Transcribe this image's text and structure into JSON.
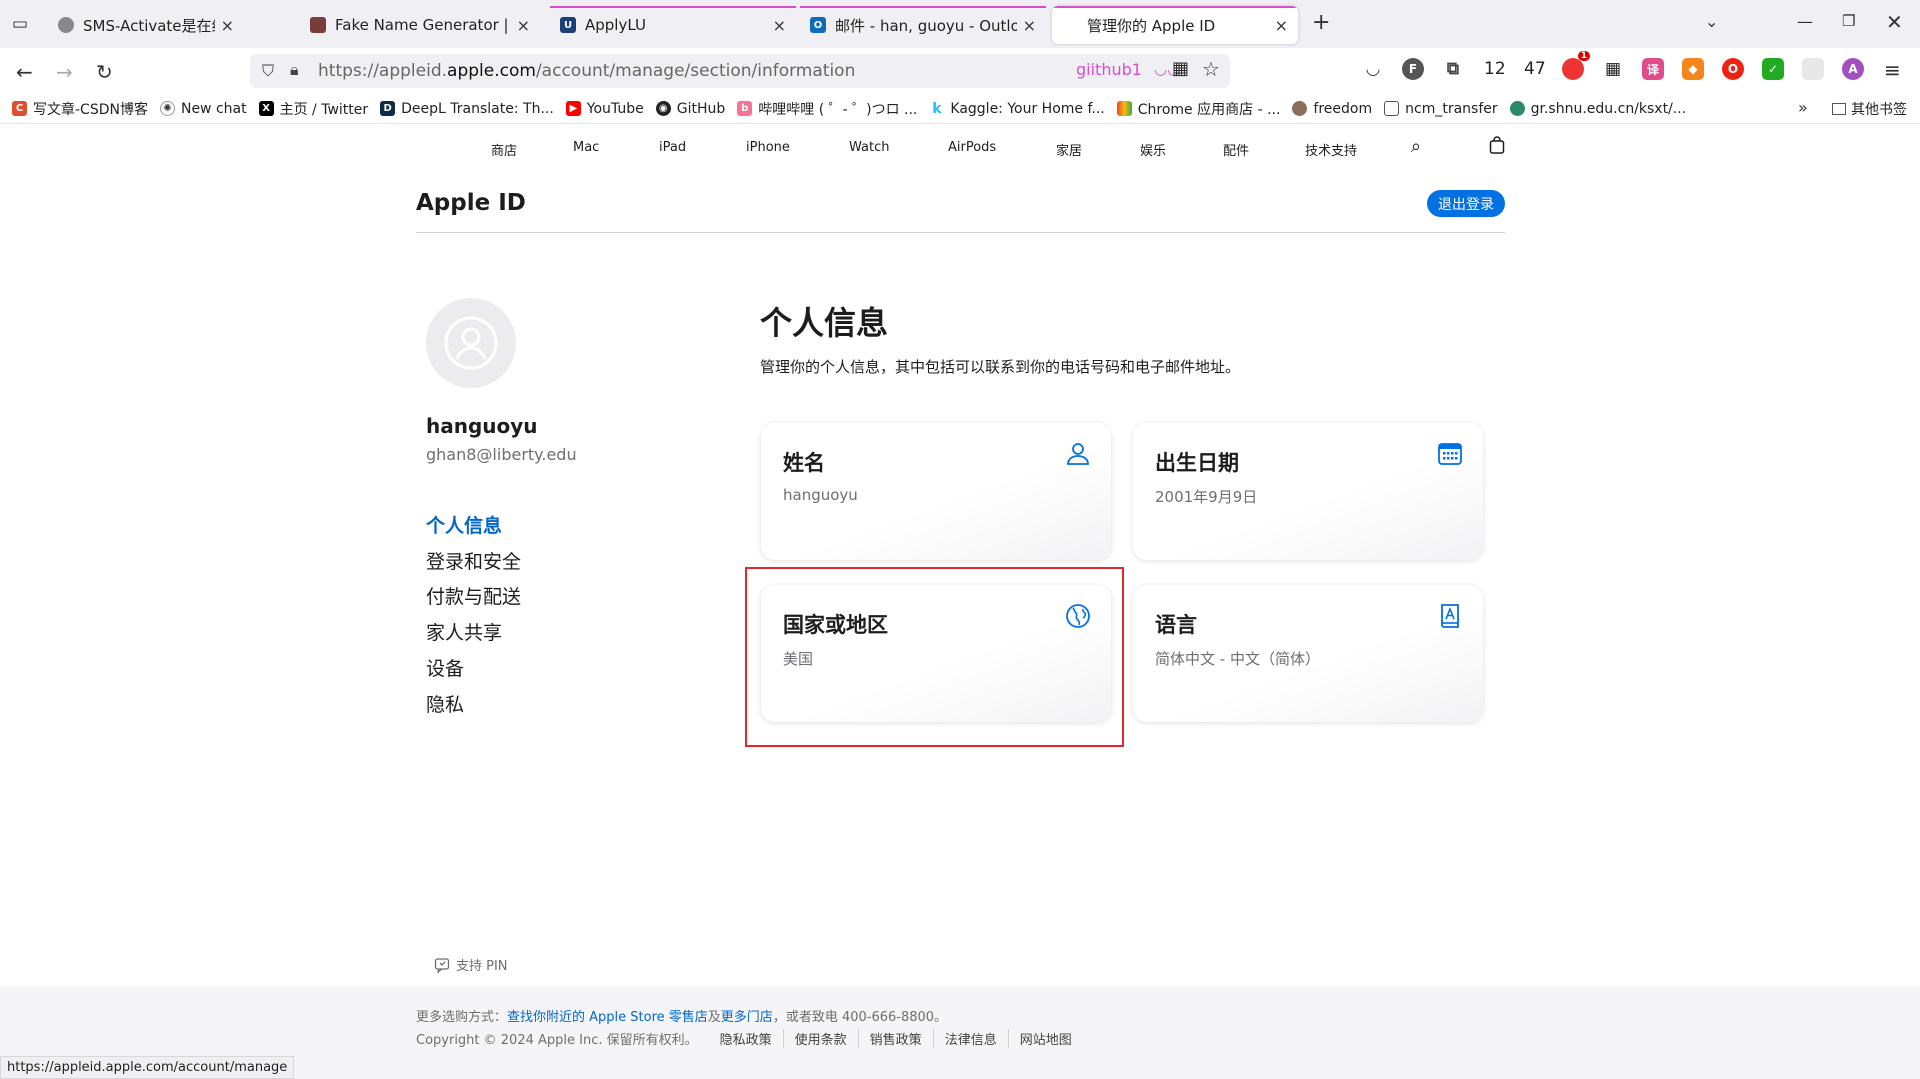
{
  "tabs": [
    {
      "label": "SMS-Activate是在线接受短信的",
      "color": "#888888"
    },
    {
      "label": "Fake Name Generator | FauxID",
      "color": "#7a3b3b"
    },
    {
      "label": "ApplyLU",
      "color": "#1c3f7a"
    },
    {
      "label": "邮件 - han, guoyu - Outlook",
      "color": "#0f6cbd"
    },
    {
      "label": "管理你的 Apple ID",
      "color": "#555555"
    }
  ],
  "tab_close": "×",
  "new_tab": "+",
  "url": {
    "prefix": "https://appleid.",
    "domain": "apple.com",
    "path": "/account/manage/section/information"
  },
  "url_extra": "giithub1",
  "ext_counts": {
    "a": "12",
    "b": "47"
  },
  "badge": "1",
  "bookmarks": [
    "写文章-CSDN博客",
    "New chat",
    "主页 / Twitter",
    "DeepL Translate: Th...",
    "YouTube",
    "GitHub",
    "哔哩哔哩 ( ゜- ゜)つロ ...",
    "Kaggle: Your Home f...",
    "Chrome 应用商店 - ...",
    "freedom",
    "ncm_transfer",
    "gr.shnu.edu.cn/ksxt/..."
  ],
  "other_bookmarks": "其他书签",
  "apple_nav": [
    "商店",
    "Mac",
    "iPad",
    "iPhone",
    "Watch",
    "AirPods",
    "家居",
    "娱乐",
    "配件",
    "技术支持"
  ],
  "page": {
    "title": "Apple ID",
    "logout": "退出登录",
    "user_name": "hanguoyu",
    "user_email": "ghan8@liberty.edu",
    "sidebar": [
      "个人信息",
      "登录和安全",
      "付款与配送",
      "家人共享",
      "设备",
      "隐私"
    ],
    "section_title": "个人信息",
    "section_desc": "管理你的个人信息，其中包括可以联系到你的电话号码和电子邮件地址。",
    "cards": [
      {
        "title": "姓名",
        "value": "hanguoyu",
        "icon": "person-icon"
      },
      {
        "title": "出生日期",
        "value": "2001年9月9日",
        "icon": "calendar-icon"
      },
      {
        "title": "国家或地区",
        "value": "美国",
        "icon": "globe-icon"
      },
      {
        "title": "语言",
        "value": "简体中文 - 中文（简体）",
        "icon": "language-icon"
      }
    ],
    "support_pin": "支持 PIN"
  },
  "footer": {
    "line1_prefix": "更多选购方式：",
    "line1_link1": "查找你附近的 Apple Store 零售店",
    "line1_mid": "及",
    "line1_link2": "更多门店",
    "line1_suffix": "，或者致电 400-666-8800。",
    "copyright": "Copyright © 2024 Apple Inc. 保留所有权利。",
    "links": [
      "隐私政策",
      "使用条款",
      "销售政策",
      "法律信息",
      "网站地图"
    ]
  },
  "status_url": "https://appleid.apple.com/account/manage",
  "colors": {
    "accent": "#0071e3",
    "link": "#0066cc",
    "highlight": "#e0282e"
  }
}
